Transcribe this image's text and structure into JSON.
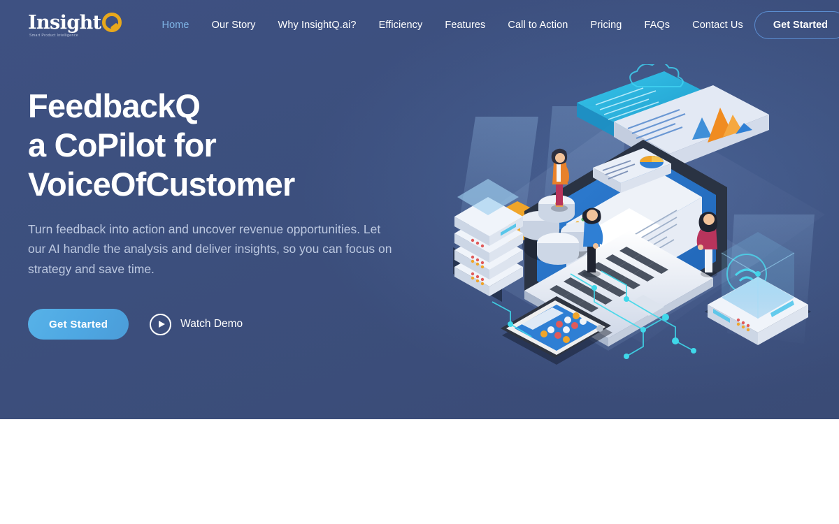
{
  "brand": {
    "name": "Insight",
    "mark_letter": "Q",
    "tagline": "Smart Product Intelligence"
  },
  "nav": {
    "items": [
      {
        "label": "Home",
        "active": true
      },
      {
        "label": "Our Story",
        "active": false
      },
      {
        "label": "Why InsightQ.ai?",
        "active": false
      },
      {
        "label": "Efficiency",
        "active": false
      },
      {
        "label": "Features",
        "active": false
      },
      {
        "label": "Call to Action",
        "active": false
      },
      {
        "label": "Pricing",
        "active": false
      },
      {
        "label": "FAQs",
        "active": false
      },
      {
        "label": "Contact Us",
        "active": false
      }
    ],
    "cta_label": "Get Started"
  },
  "hero": {
    "title_lines": [
      "FeedbackQ",
      "a CoPilot for",
      "VoiceOfCustomer"
    ],
    "subtitle": "Turn feedback into action and uncover revenue opportunities. Let our AI handle the analysis and deliver insights, so you can focus on strategy and save time.",
    "primary_cta": "Get Started",
    "secondary_cta": "Watch Demo",
    "illustration_alt": "Isometric data analytics scene with laptop, dashboards, server racks, smartphone and people"
  },
  "colors": {
    "hero_background": "#3d5080",
    "nav_active": "#7fb4e6",
    "primary_button": "#4ea7e2",
    "brand_accent": "#e8a81c",
    "body_text": "#bcc8e0",
    "page_background": "#ffffff"
  }
}
